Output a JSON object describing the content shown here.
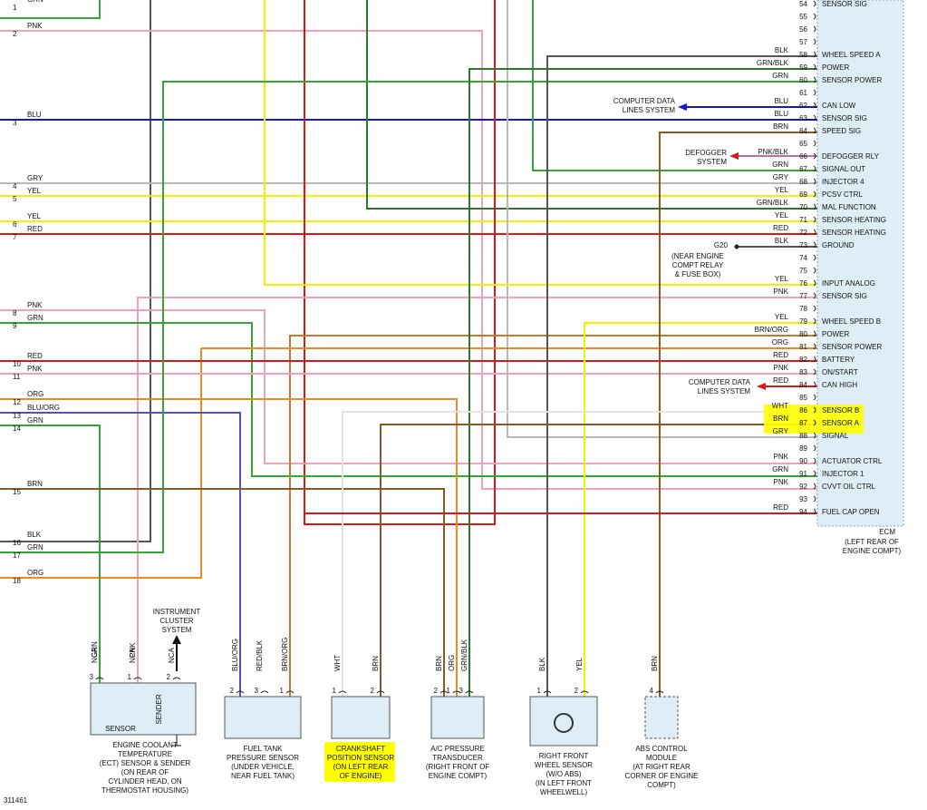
{
  "figure_id": "311461",
  "colors": {
    "GRN": "#33a633",
    "PNK": "#f3a0c0",
    "BLU": "#1515d6",
    "GRY": "#b8b8b8",
    "YEL": "#f2f200",
    "RED": "#e01515",
    "BLK": "#555555",
    "ORG": "#ef8a1e",
    "BRN": "#8a5a22",
    "WHT": "#e4e4e4",
    "BLU/ORG": "#5050c8",
    "RED/BLK": "#b02020",
    "BRN/ORG": "#c07a30",
    "GRN/BLK": "#2a7a2a",
    "PNK/BLK": "#c070a0",
    "BRN/BLK_legacy": "#6a4a22",
    "ecm_fill": "#dfeef6",
    "ecm_border": "#7aa7bf",
    "highlight": "#ffff00"
  },
  "left_connector": [
    {
      "num": "1",
      "color": "GRN"
    },
    {
      "num": "2",
      "color": "PNK"
    },
    {
      "num": "3",
      "color": "BLU"
    },
    {
      "num": "4",
      "color": "GRY"
    },
    {
      "num": "5",
      "color": "YEL"
    },
    {
      "num": "6",
      "color": "YEL"
    },
    {
      "num": "7",
      "color": "RED"
    },
    {
      "num": "8",
      "color": "PNK"
    },
    {
      "num": "9",
      "color": "GRN"
    },
    {
      "num": "10",
      "color": "RED"
    },
    {
      "num": "11",
      "color": "PNK"
    },
    {
      "num": "12",
      "color": "ORG"
    },
    {
      "num": "13",
      "color": "BLU/ORG"
    },
    {
      "num": "14",
      "color": "GRN"
    },
    {
      "num": "15",
      "color": "BRN"
    },
    {
      "num": "16",
      "color": "BLK"
    },
    {
      "num": "17",
      "color": "GRN"
    },
    {
      "num": "18",
      "color": "ORG"
    }
  ],
  "ecm": {
    "label": "ECM",
    "location": [
      "(LEFT REAR OF",
      "ENGINE COMPT)"
    ],
    "pins": [
      {
        "num": "54",
        "wire": "",
        "name": "SENSOR SIG"
      },
      {
        "num": "55",
        "wire": "",
        "name": ""
      },
      {
        "num": "56",
        "wire": "",
        "name": ""
      },
      {
        "num": "57",
        "wire": "",
        "name": ""
      },
      {
        "num": "58",
        "wire": "BLK",
        "name": "WHEEL SPEED A"
      },
      {
        "num": "59",
        "wire": "GRN/BLK",
        "name": "POWER"
      },
      {
        "num": "60",
        "wire": "GRN",
        "name": "SENSOR POWER"
      },
      {
        "num": "61",
        "wire": "",
        "name": ""
      },
      {
        "num": "62",
        "wire": "BLU",
        "name": "CAN LOW"
      },
      {
        "num": "63",
        "wire": "BLU",
        "name": "SENSOR SIG"
      },
      {
        "num": "64",
        "wire": "BRN",
        "name": "SPEED SIG"
      },
      {
        "num": "65",
        "wire": "",
        "name": ""
      },
      {
        "num": "66",
        "wire": "PNK/BLK",
        "name": "DEFOGGER RLY"
      },
      {
        "num": "67",
        "wire": "GRN",
        "name": "SIGNAL OUT"
      },
      {
        "num": "68",
        "wire": "GRY",
        "name": "INJECTOR 4"
      },
      {
        "num": "69",
        "wire": "YEL",
        "name": "PCSV CTRL"
      },
      {
        "num": "70",
        "wire": "GRN/BLK",
        "name": "MAL FUNCTION"
      },
      {
        "num": "71",
        "wire": "YEL",
        "name": "SENSOR HEATING"
      },
      {
        "num": "72",
        "wire": "RED",
        "name": "SENSOR HEATING"
      },
      {
        "num": "73",
        "wire": "BLK",
        "name": "GROUND"
      },
      {
        "num": "74",
        "wire": "",
        "name": ""
      },
      {
        "num": "75",
        "wire": "",
        "name": ""
      },
      {
        "num": "76",
        "wire": "YEL",
        "name": "INPUT ANALOG"
      },
      {
        "num": "77",
        "wire": "PNK",
        "name": "SENSOR SIG"
      },
      {
        "num": "78",
        "wire": "",
        "name": ""
      },
      {
        "num": "79",
        "wire": "YEL",
        "name": "WHEEL SPEED B"
      },
      {
        "num": "80",
        "wire": "BRN/ORG",
        "name": "POWER"
      },
      {
        "num": "81",
        "wire": "ORG",
        "name": "SENSOR POWER"
      },
      {
        "num": "82",
        "wire": "RED",
        "name": "BATTERY"
      },
      {
        "num": "83",
        "wire": "PNK",
        "name": "ON/START"
      },
      {
        "num": "84",
        "wire": "RED",
        "name": "CAN HIGH"
      },
      {
        "num": "85",
        "wire": "",
        "name": ""
      },
      {
        "num": "86",
        "wire": "WHT",
        "name": "SENSOR B"
      },
      {
        "num": "87",
        "wire": "BRN",
        "name": "SENSOR A"
      },
      {
        "num": "88",
        "wire": "GRY",
        "name": "SIGNAL"
      },
      {
        "num": "89",
        "wire": "",
        "name": ""
      },
      {
        "num": "90",
        "wire": "PNK",
        "name": "ACTUATOR CTRL"
      },
      {
        "num": "91",
        "wire": "GRN",
        "name": "INJECTOR 1"
      },
      {
        "num": "92",
        "wire": "PNK",
        "name": "CVVT OIL CTRL"
      },
      {
        "num": "93",
        "wire": "",
        "name": ""
      },
      {
        "num": "94",
        "wire": "RED",
        "name": "FUEL CAP OPEN"
      }
    ]
  },
  "external_refs": {
    "can_low": [
      "COMPUTER DATA",
      "LINES SYSTEM"
    ],
    "defogger": [
      "DEFOGGER",
      "SYSTEM"
    ],
    "ground_id": "G20",
    "ground_desc": [
      "(NEAR ENGINE",
      "COMPT RELAY",
      "& FUSE BOX)"
    ],
    "can_high": [
      "COMPUTER DATA",
      "LINES SYSTEM"
    ],
    "instrument_cluster": [
      "INSTRUMENT",
      "CLUSTER",
      "SYSTEM"
    ]
  },
  "components": [
    {
      "id": "ect",
      "title": [
        "ENGINE COOLANT",
        "TEMPERATURE",
        "(ECT) SENSOR & SENDER",
        "(ON REAR OF",
        "CYLINDER HEAD, ON",
        "THERMOSTAT HOUSING)"
      ],
      "inner_labels": [
        "SENSOR",
        "SENDER"
      ],
      "pins": [
        {
          "num": "3",
          "wire": "GRN",
          "nca": "NCA"
        },
        {
          "num": "1",
          "wire": "PNK",
          "nca": "NCA"
        },
        {
          "num": "2",
          "wire": "",
          "nca": "NCA"
        }
      ]
    },
    {
      "id": "fuel_tank",
      "title": [
        "FUEL TANK",
        "PRESSURE SENSOR",
        "(UNDER VEHICLE,",
        "NEAR FUEL TANK)"
      ],
      "pins": [
        {
          "num": "2",
          "wire": "BLU/ORG"
        },
        {
          "num": "3",
          "wire": "RED/BLK"
        },
        {
          "num": "1",
          "wire": "BRN/ORG"
        }
      ]
    },
    {
      "id": "ckp",
      "title": [
        "CRANKSHAFT",
        "POSITION SENSOR",
        "(ON LEFT REAR",
        "OF ENGINE)"
      ],
      "pins": [
        {
          "num": "1",
          "wire": "WHT"
        },
        {
          "num": "2",
          "wire": "BRN"
        }
      ]
    },
    {
      "id": "ac",
      "title": [
        "A/C PRESSURE",
        "TRANSDUCER",
        "(RIGHT FRONT OF",
        "ENGINE COMPT)"
      ],
      "pins": [
        {
          "num": "2",
          "wire": "BRN"
        },
        {
          "num": "1",
          "wire": "ORG"
        },
        {
          "num": "3",
          "wire": "GRN/BLK"
        }
      ]
    },
    {
      "id": "wss",
      "title": [
        "RIGHT FRONT",
        "WHEEL SENSOR",
        "(W/O ABS)",
        "(IN LEFT FRONT",
        "WHEELWELL)"
      ],
      "pins": [
        {
          "num": "1",
          "wire": "BLK"
        },
        {
          "num": "2",
          "wire": "YEL"
        }
      ]
    },
    {
      "id": "abs",
      "title": [
        "ABS CONTROL",
        "MODULE",
        "(AT RIGHT REAR",
        "CORNER OF ENGINE",
        "COMPT)"
      ],
      "pins": [
        {
          "num": "4",
          "wire": "BRN"
        }
      ]
    }
  ]
}
